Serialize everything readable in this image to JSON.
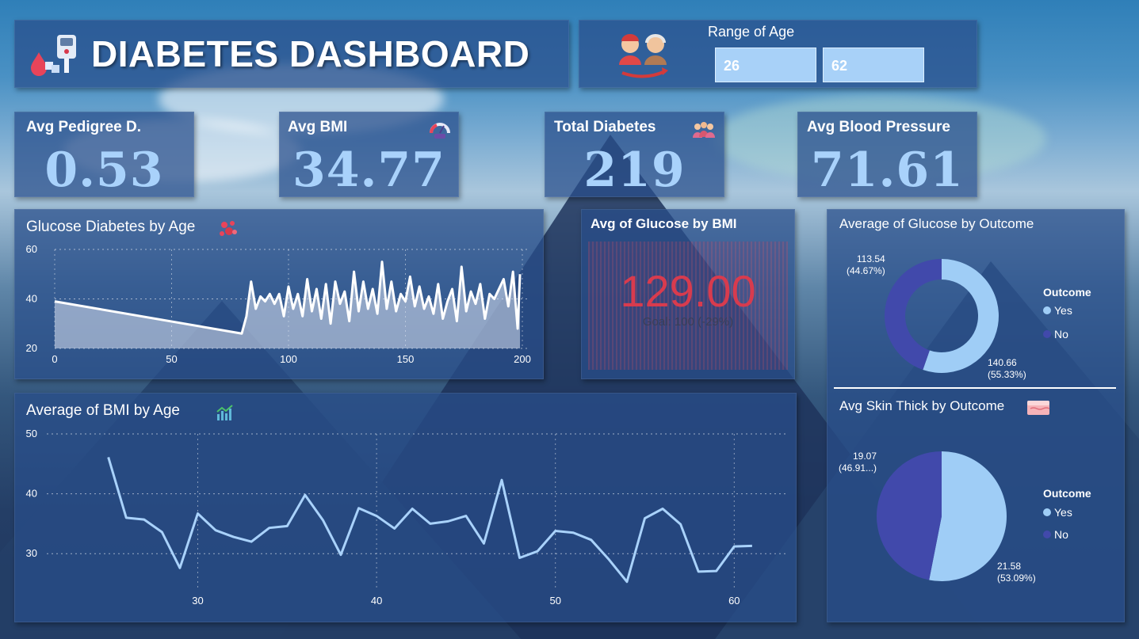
{
  "colors": {
    "accent_light": "#a9d2fb",
    "yes": "#9fcdf6",
    "no": "#4149ab",
    "card_value_red": "#d83b4e",
    "panel": "#284e8a"
  },
  "header": {
    "title": "DIABETES DASHBOARD",
    "icon": "glucose-meter-icon"
  },
  "age_filter": {
    "label": "Range of Age",
    "min": "26",
    "max": "62",
    "icon": "young-old-people-icon"
  },
  "kpis": [
    {
      "label": "Avg Pedigree D.",
      "value": "0.53",
      "icon": ""
    },
    {
      "label": "Avg BMI",
      "value": "34.77",
      "icon": "bmi-gauge-icon"
    },
    {
      "label": "Total Diabetes",
      "value": "219",
      "icon": "people-group-icon"
    },
    {
      "label": "Avg Blood Pressure",
      "value": "71.61",
      "icon": ""
    }
  ],
  "glucose_card": {
    "title": "Avg of Glucose by BMI",
    "value": "129.00",
    "goal": "Goal: 100 (-29%)"
  },
  "donut_outcome": {
    "title": "Average of Glucose by Outcome",
    "legend_title": "Outcome",
    "legend": [
      "Yes",
      "No"
    ],
    "slices": [
      {
        "name": "Yes",
        "value": 140.66,
        "label": "140.66",
        "pct": "(55.33%)"
      },
      {
        "name": "No",
        "value": 113.54,
        "label": "113.54",
        "pct": "(44.67%)"
      }
    ]
  },
  "pie_skin": {
    "title": "Avg Skin Thick by Outcome",
    "legend_title": "Outcome",
    "legend": [
      "Yes",
      "No"
    ],
    "slices": [
      {
        "name": "Yes",
        "value": 21.58,
        "label": "21.58",
        "pct": "(53.09%)"
      },
      {
        "name": "No",
        "value": 19.07,
        "label": "19.07",
        "pct": "(46.91...)"
      }
    ]
  },
  "chart_data": [
    {
      "type": "area",
      "title": "Glucose Diabetes by Age",
      "xlim": [
        0,
        200
      ],
      "ylim": [
        20,
        60
      ],
      "x_ticks": [
        "0",
        "50",
        "100",
        "150",
        "200"
      ],
      "y_ticks": [
        "20",
        "40",
        "60"
      ],
      "grid": true,
      "x": [
        0,
        80,
        82,
        84,
        86,
        88,
        90,
        92,
        94,
        96,
        98,
        100,
        102,
        104,
        106,
        108,
        110,
        112,
        114,
        116,
        118,
        120,
        122,
        124,
        126,
        128,
        130,
        132,
        134,
        136,
        138,
        140,
        142,
        144,
        146,
        148,
        150,
        152,
        154,
        156,
        158,
        160,
        162,
        164,
        166,
        168,
        170,
        172,
        174,
        176,
        178,
        180,
        182,
        184,
        186,
        188,
        190,
        192,
        194,
        196,
        198,
        199
      ],
      "values": [
        39,
        26,
        33,
        47,
        36,
        41,
        39,
        42,
        38,
        42,
        33,
        45,
        36,
        42,
        33,
        48,
        35,
        44,
        32,
        46,
        30,
        47,
        38,
        43,
        31,
        51,
        35,
        47,
        36,
        44,
        34,
        55,
        36,
        47,
        35,
        42,
        39,
        49,
        37,
        45,
        36,
        41,
        34,
        46,
        32,
        39,
        44,
        31,
        53,
        35,
        43,
        38,
        46,
        32,
        42,
        40,
        44,
        48,
        37,
        51,
        28,
        50
      ]
    },
    {
      "type": "line",
      "title": "Average of BMI by Age",
      "xlim": [
        22,
        63
      ],
      "ylim": [
        25,
        50
      ],
      "x_ticks": [
        "30",
        "40",
        "50",
        "60"
      ],
      "y_ticks": [
        "30",
        "40",
        "50"
      ],
      "grid": true,
      "x": [
        22,
        23,
        24,
        25,
        26,
        27,
        28,
        29,
        30,
        31,
        32,
        33,
        34,
        35,
        36,
        37,
        38,
        39,
        40,
        41,
        42,
        43,
        44,
        45,
        46,
        47,
        48,
        49,
        50,
        51,
        52,
        53,
        54,
        55,
        56,
        57,
        58,
        59,
        60,
        61,
        62
      ],
      "values": [
        46.1,
        36.0,
        35.7,
        33.6,
        27.6,
        36.7,
        33.9,
        32.8,
        32.0,
        34.3,
        34.6,
        39.8,
        35.6,
        29.8,
        37.6,
        36.3,
        34.2,
        37.5,
        35.0,
        35.4,
        36.3,
        31.7,
        42.3,
        29.3,
        30.4,
        33.8,
        33.5,
        32.3,
        29.0,
        25.3,
        35.9,
        37.5,
        34.9,
        27.0,
        27.1,
        31.2,
        31.3
      ]
    }
  ]
}
